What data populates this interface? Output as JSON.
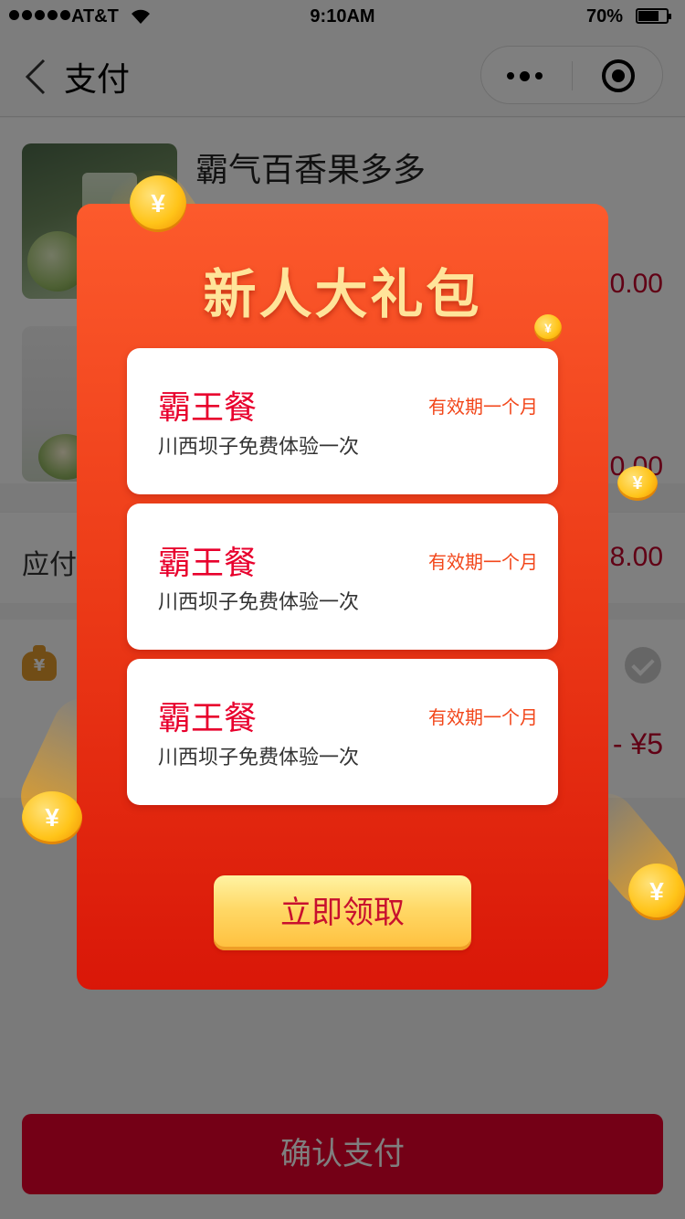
{
  "status_bar": {
    "carrier": "AT&T",
    "time": "9:10AM",
    "battery": "70%"
  },
  "nav": {
    "title": "支付"
  },
  "products": [
    {
      "name": "霸气百香果多多",
      "price": "20.00"
    },
    {
      "name": "",
      "price": "0.00"
    }
  ],
  "payable": {
    "label": "应付",
    "amount": "8.00"
  },
  "discount": {
    "label": "",
    "amount": "- ¥5"
  },
  "confirm_label": "确认支付",
  "gift_modal": {
    "title": "新人大礼包",
    "vouchers": [
      {
        "name": "霸王餐",
        "validity": "有效期一个月",
        "desc": "川西坝子免费体验一次"
      },
      {
        "name": "霸王餐",
        "validity": "有效期一个月",
        "desc": "川西坝子免费体验一次"
      },
      {
        "name": "霸王餐",
        "validity": "有效期一个月",
        "desc": "川西坝子免费体验一次"
      }
    ],
    "claim_label": "立即领取"
  },
  "coin_glyph": "¥",
  "colors": {
    "accent": "#e8002d",
    "modal_top": "#fc5a2c",
    "modal_bottom": "#d91708",
    "title_gold": "#ffe49a"
  }
}
